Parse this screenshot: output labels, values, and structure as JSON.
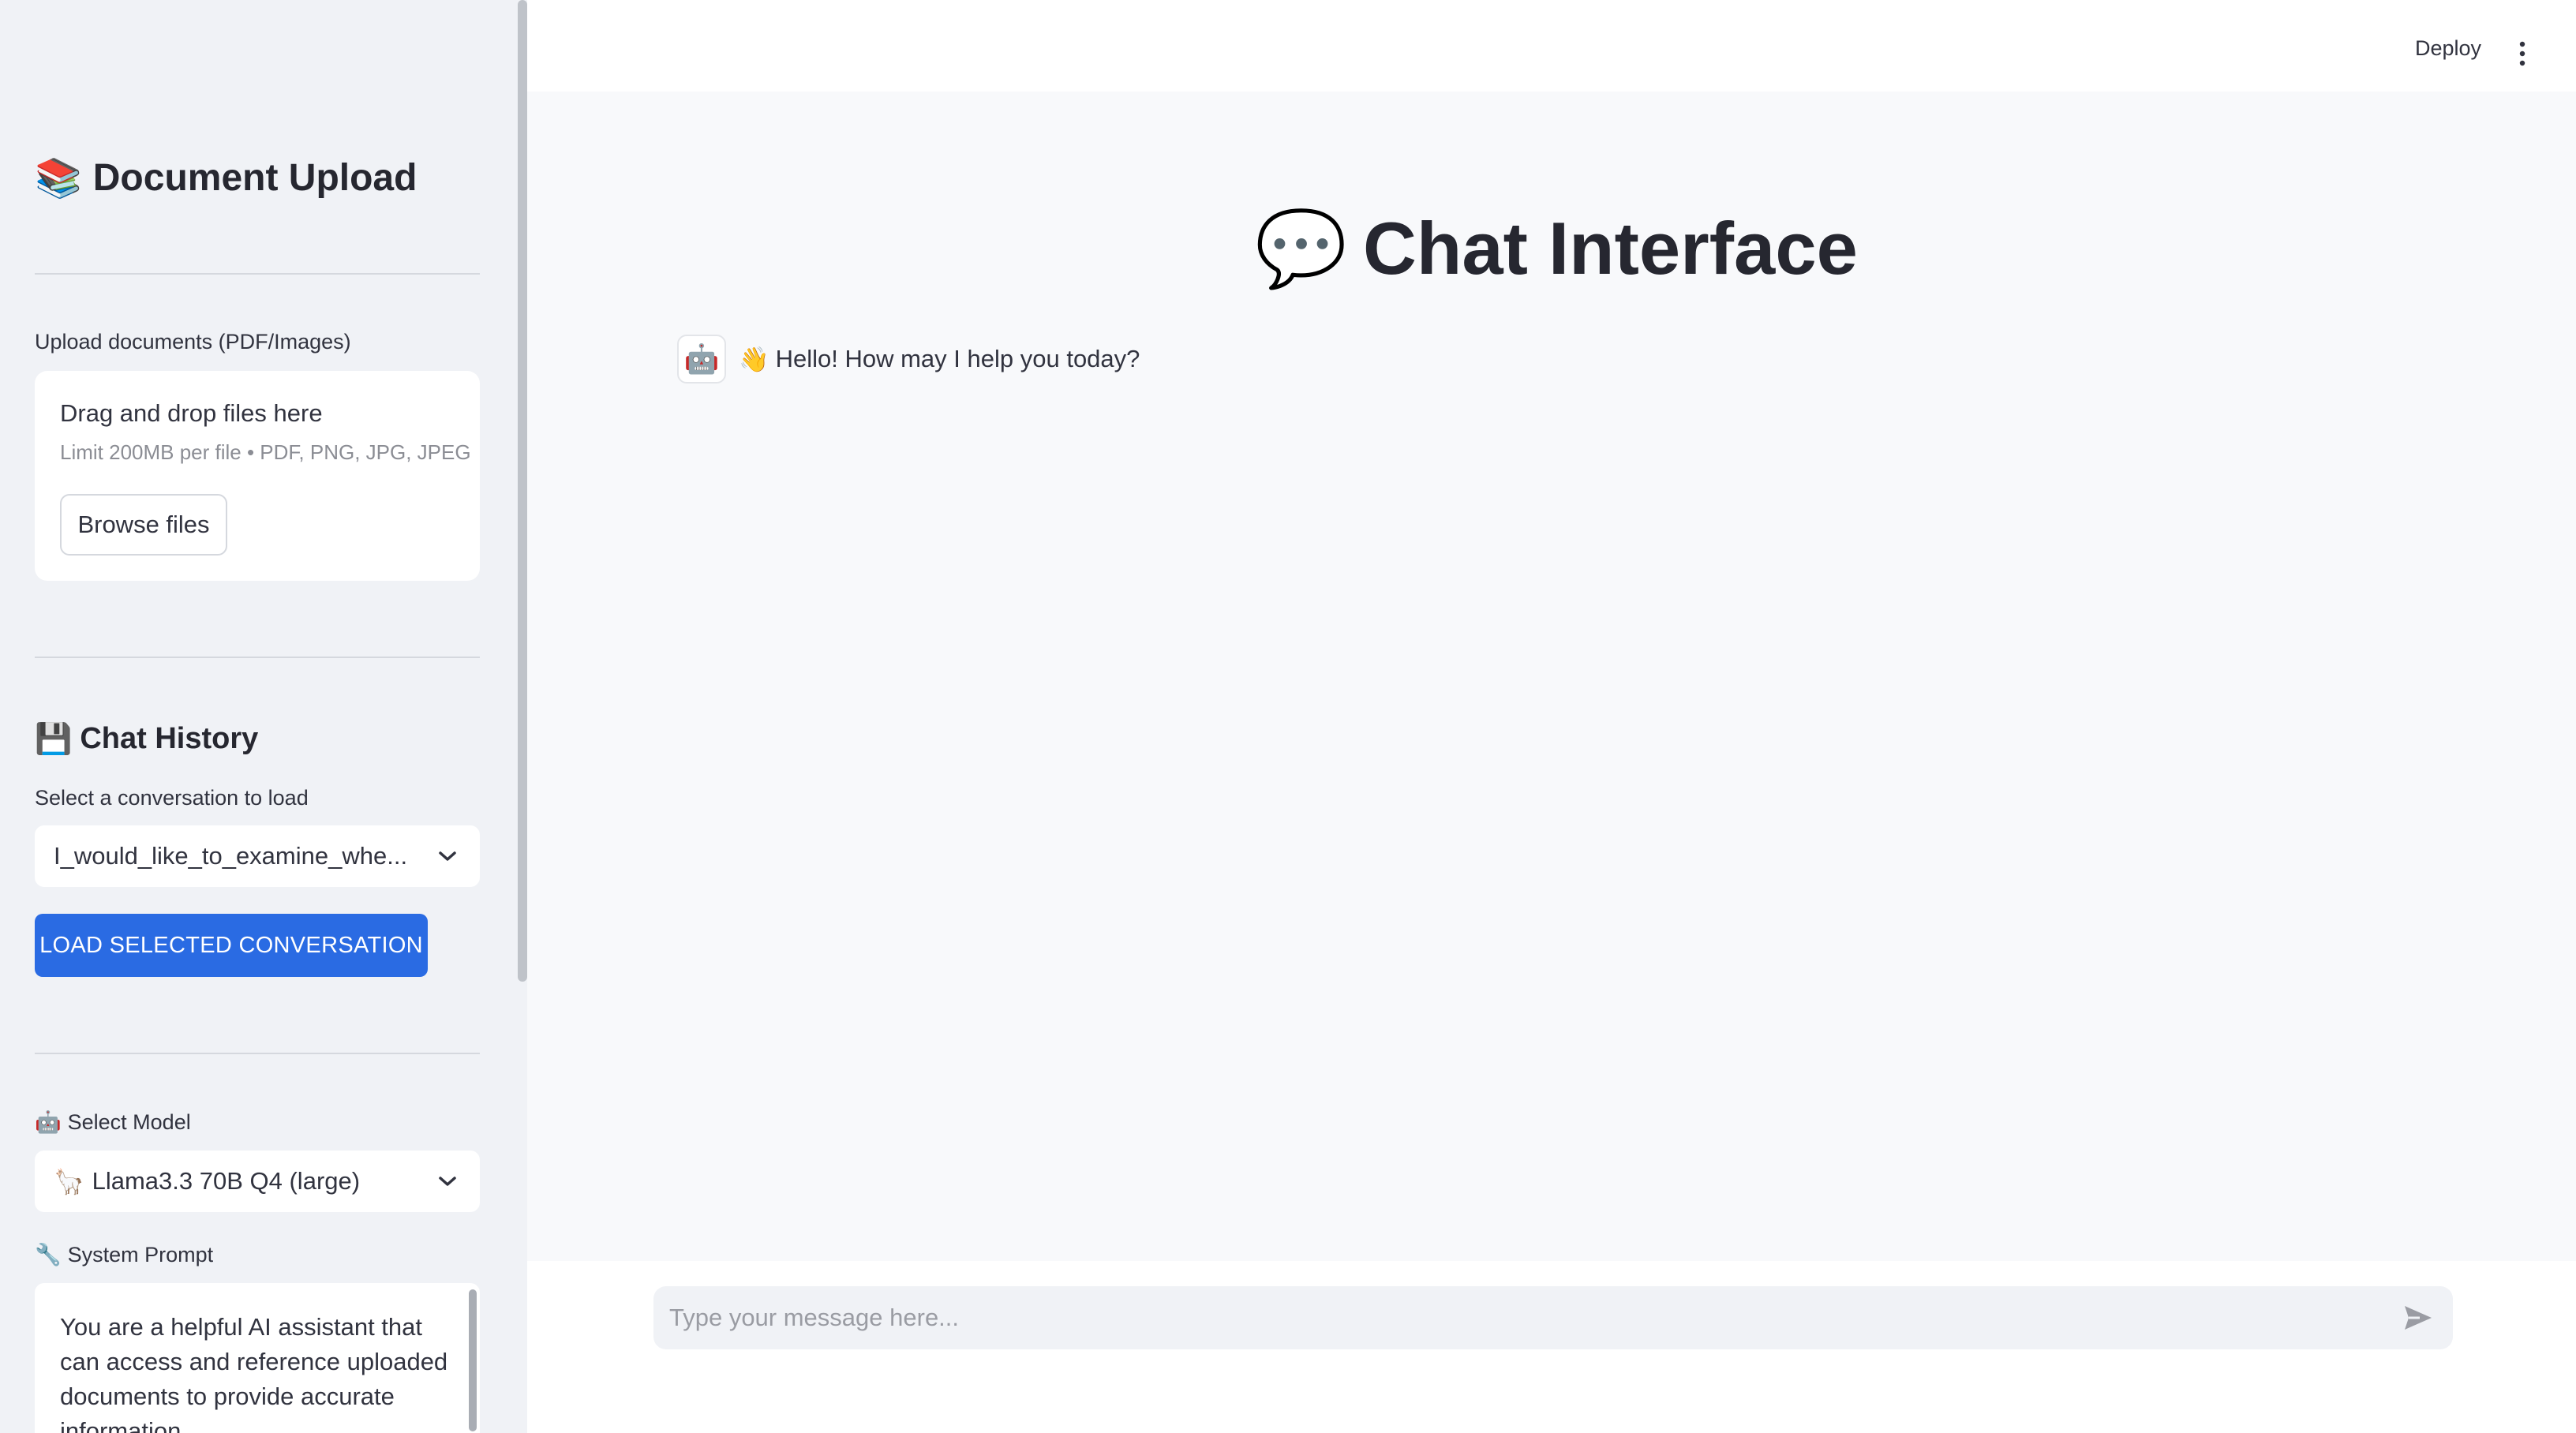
{
  "sidebar": {
    "title_icon": "📚",
    "title": "Document Upload",
    "upload": {
      "label": "Upload documents (PDF/Images)",
      "drop_title": "Drag and drop files here",
      "drop_hint": "Limit 200MB per file • PDF, PNG, JPG, JPEG",
      "browse_label": "Browse files"
    },
    "history": {
      "icon": "💾",
      "title": "Chat History",
      "select_label": "Select a conversation to load",
      "selected_value": "I_would_like_to_examine_whe...",
      "load_button": "LOAD SELECTED CONVERSATION"
    },
    "model": {
      "icon": "🤖",
      "label": "Select Model",
      "selected_icon": "🦙",
      "selected_value": "Llama3.3 70B Q4 (large)"
    },
    "system_prompt": {
      "icon": "🔧",
      "label": "System Prompt",
      "value": "You are a helpful AI assistant that can access and reference uploaded documents to provide accurate information."
    }
  },
  "header": {
    "deploy_label": "Deploy",
    "menu_icon": "kebab-menu-icon"
  },
  "main": {
    "title_icon": "💬",
    "title": "Chat Interface",
    "messages": [
      {
        "avatar": "🤖",
        "emoji": "👋",
        "text": "Hello! How may I help you today?"
      }
    ],
    "input": {
      "placeholder": "Type your message here...",
      "send_icon": "send-icon"
    }
  },
  "colors": {
    "accent": "#2a6be3",
    "sidebar_bg": "#f0f2f6",
    "main_bg": "#f8f9fb",
    "text": "#31333f"
  }
}
